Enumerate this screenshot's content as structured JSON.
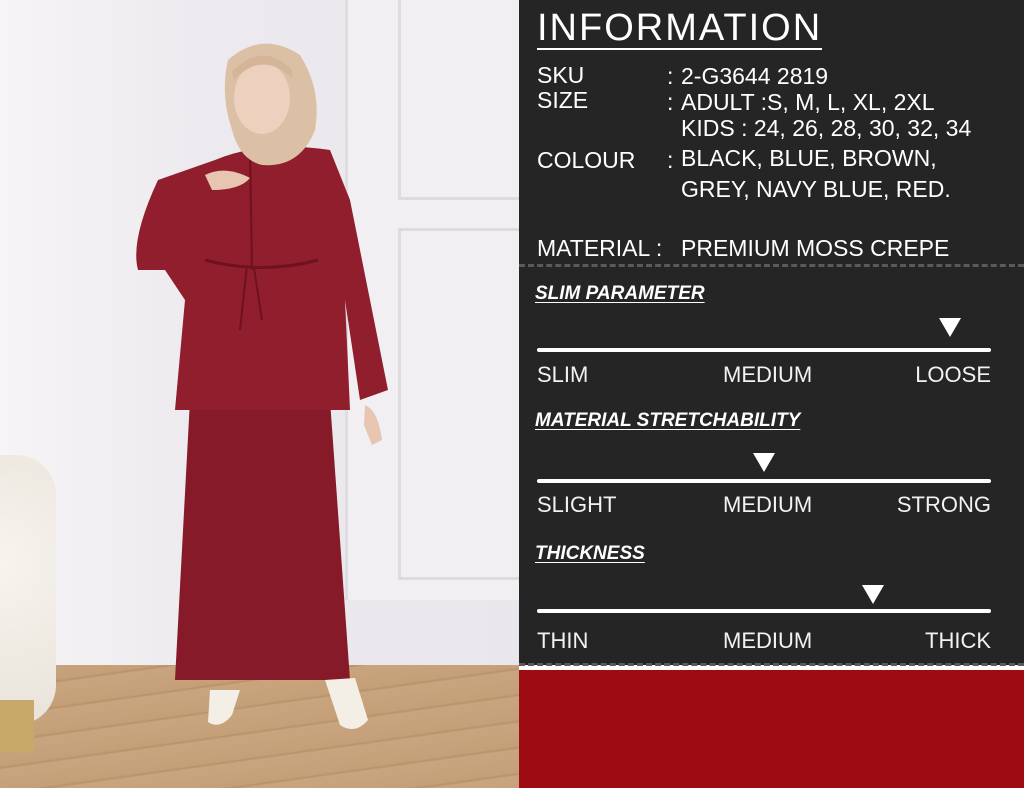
{
  "info": {
    "title": "INFORMATION",
    "sku_label": "SKU",
    "sku_value": "2-G3644 2819",
    "size_label": "SIZE",
    "size_adult": "ADULT :S, M, L, XL, 2XL",
    "size_kids": "KIDS : 24, 26, 28, 30, 32, 34",
    "colour_label": "COLOUR",
    "colour_line1": "BLACK, BLUE, BROWN,",
    "colour_line2": "GREY, NAVY BLUE, RED.",
    "material_label": "MATERIAL :",
    "material_value": "PREMIUM MOSS CREPE",
    "colon": ":"
  },
  "parameters": [
    {
      "title": "SLIM PARAMETER",
      "left": "SLIM",
      "mid": "MEDIUM",
      "right": "LOOSE",
      "level": 0.91
    },
    {
      "title": "MATERIAL STRETCHABILITY",
      "left": "SLIGHT",
      "mid": "MEDIUM",
      "right": "STRONG",
      "level": 0.5
    },
    {
      "title": "THICKNESS",
      "left": "THIN",
      "mid": "MEDIUM",
      "right": "THICK",
      "level": 0.74
    }
  ],
  "colors": {
    "panel_bg": "#252525",
    "accent_red": "#9c0c12",
    "dress_red": "#8c1d2c"
  }
}
